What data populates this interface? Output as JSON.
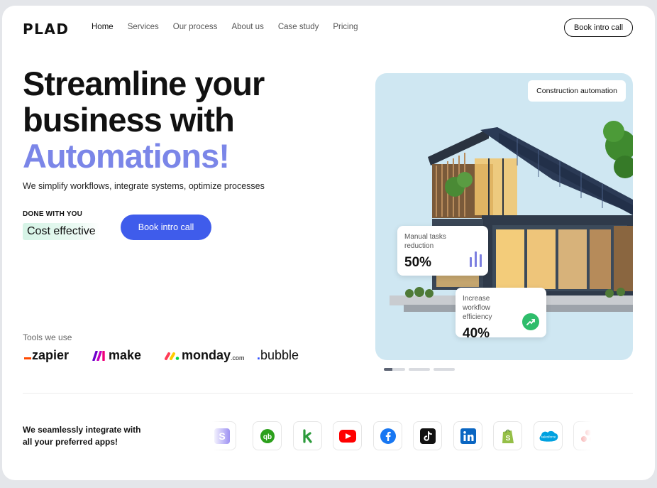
{
  "brand": {
    "logo": "PLAD"
  },
  "nav": {
    "items": [
      "Home",
      "Services",
      "Our process",
      "About us",
      "Case study",
      "Pricing"
    ],
    "active": "Home",
    "cta": "Book intro call"
  },
  "hero": {
    "title_line1": "Streamline your",
    "title_line2": "business with",
    "title_accent": "Automations!",
    "subtitle": "We simplify workflows, integrate systems, optimize processes",
    "tag_label": "DONE WITH YOU",
    "highlight": "Cost effective",
    "cta": "Book intro call"
  },
  "tools": {
    "label": "Tools we use",
    "items": {
      "zapier": "zapier",
      "make": "make",
      "monday": "monday",
      "monday_suffix": ".com",
      "bubble": "bubble",
      "bubble_dot": "."
    }
  },
  "showcase": {
    "tag": "Construction automation",
    "stats": [
      {
        "label": "Manual tasks reduction",
        "value": "50%"
      },
      {
        "label": "Increase workflow efficiency",
        "value": "40%"
      }
    ],
    "carousel": {
      "count": 3,
      "active": 1
    }
  },
  "integrations": {
    "text_line1": "We seamlessly integrate with",
    "text_line2": "all your preferred apps!",
    "apps": [
      "stripe-icon",
      "quickbooks-icon",
      "keap-icon",
      "youtube-icon",
      "facebook-icon",
      "tiktok-icon",
      "linkedin-icon",
      "shopify-icon",
      "salesforce-icon",
      "asana-icon"
    ],
    "salesforce_text": "salesforce"
  },
  "colors": {
    "accent": "#7b86e8",
    "cta": "#3f5ceb",
    "panel_bg": "#cfe7f2",
    "highlight": "#d5f4e6",
    "growth": "#2ebd6b"
  }
}
